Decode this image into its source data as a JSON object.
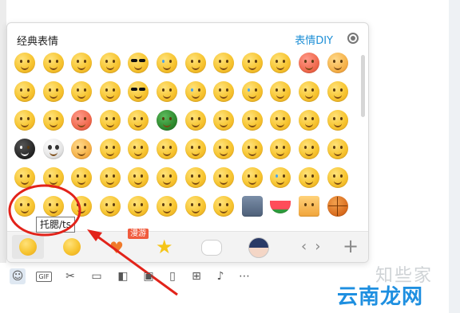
{
  "panel": {
    "title": "经典表情",
    "diy_label": "表情DIY",
    "settings_icon": "settings-gear-icon"
  },
  "emoji_rows": [
    [
      "smile",
      "grin",
      "heart-eyes",
      "weary",
      "cool-sunglasses",
      "crying",
      "blush",
      "sleepy",
      "wince",
      "sweat",
      "angry-red",
      "boxed-angry"
    ],
    [
      "tongue",
      "big-grin",
      "sad",
      "frown",
      "sunglasses-grin",
      "shy",
      "laugh-tears",
      "thinking",
      "teary",
      "cross-eyed",
      "surprised",
      "unamused"
    ],
    [
      "drooling",
      "smirk",
      "furious",
      "doh",
      "awkward",
      "soldier-helmet",
      "pirate-bandana",
      "screaming",
      "thinking-hand",
      "shushing",
      "dizzy",
      "pouting"
    ],
    [
      "black-bug",
      "skull",
      "hammer",
      "poking",
      "peeking",
      "sweating",
      "grimace",
      "grinning",
      "wave",
      "applause",
      "sticking-tongue",
      "happy-shy"
    ],
    [
      "scowl",
      "sulking",
      "sly",
      "cute",
      "peeking-smile",
      "kiss",
      "tears-joy",
      "confused",
      "kissing",
      "crying",
      "waving",
      "cheeky"
    ],
    [
      "facepalm",
      "tooth-ache",
      "salute",
      "shocked",
      "oops",
      "innocent",
      "covering-face",
      "delighted",
      "knife",
      "watermelon",
      "beer",
      "basketball"
    ]
  ],
  "tooltip": "托腮/ts",
  "tabs": {
    "badge": "漫游",
    "items": [
      "classic-face-tab",
      "emoji-face-tab",
      "heart-tab",
      "favorites-star-tab",
      "cat-tab",
      "avatar-tab"
    ]
  },
  "toolbar": {
    "gif_label": "GIF",
    "tools": [
      "smiley-icon",
      "gif-icon",
      "scissors-icon",
      "folder-icon",
      "image-edit-icon",
      "picture-icon",
      "phone-shake-icon",
      "red-packet-icon",
      "voice-icon",
      "more-icon"
    ]
  },
  "watermark": {
    "top_text": "知些家",
    "brand_text": "云南龙网"
  },
  "colors": {
    "link": "#1e8fd6",
    "annotation": "#e2231a",
    "brand": "#1e8fe0"
  }
}
